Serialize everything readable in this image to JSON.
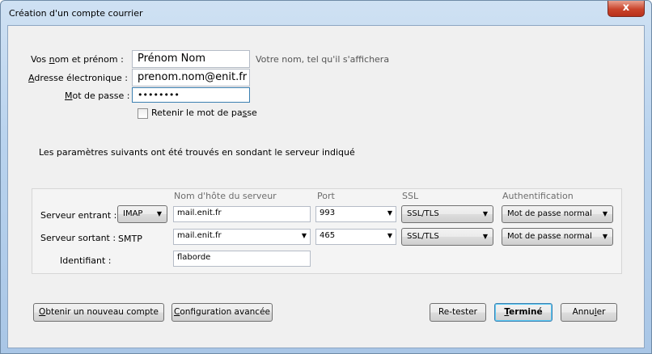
{
  "window": {
    "title": "Création d'un compte courrier",
    "close_glyph": "x"
  },
  "identity": {
    "name_label_a": "Vos ",
    "name_label_u": "n",
    "name_label_b": "om et prénom :",
    "name_value": "Prénom Nom",
    "name_hint": "Votre nom, tel qu'il s'affichera",
    "email_label_u": "A",
    "email_label_b": "dresse électronique :",
    "email_value": "prenom.nom@enit.fr",
    "password_label_u": "M",
    "password_label_b": "ot de passe :",
    "password_masked": "••••••••",
    "remember_a": "Retenir le mot de pa",
    "remember_u": "s",
    "remember_b": "se"
  },
  "info_text": "Les paramètres suivants ont été trouvés en sondant le serveur indiqué",
  "server_table": {
    "headers": {
      "host": "Nom d'hôte du serveur",
      "port": "Port",
      "ssl": "SSL",
      "auth": "Authentification"
    },
    "incoming": {
      "label": "Serveur entrant :",
      "protocol": "IMAP",
      "host": "mail.enit.fr",
      "port": "993",
      "ssl": "SSL/TLS",
      "auth": "Mot de passe normal"
    },
    "outgoing": {
      "label": "Serveur sortant :",
      "protocol": "SMTP",
      "host": "mail.enit.fr",
      "port": "465",
      "ssl": "SSL/TLS",
      "auth": "Mot de passe normal"
    },
    "username": {
      "label": "Identifiant :",
      "value": "flaborde"
    }
  },
  "buttons": {
    "new_account_u": "O",
    "new_account_b": "btenir un nouveau compte",
    "advanced_u": "C",
    "advanced_b": "onfiguration avancée",
    "retest": "Re-tester",
    "done_u": "T",
    "done_b": "erminé",
    "cancel_a": "Annu",
    "cancel_u": "l",
    "cancel_b": "er"
  },
  "colors": {
    "title_gradient": "#b9d3ee",
    "close_red": "#c9442b",
    "client_bg": "#f0f0f0"
  }
}
